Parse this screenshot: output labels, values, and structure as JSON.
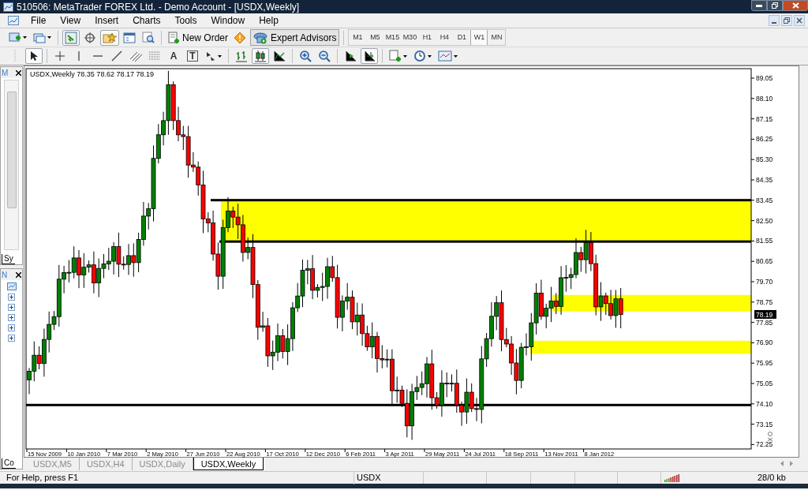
{
  "window": {
    "title": "510506: MetaTrader FOREX Ltd. - Demo Account - [USDX,Weekly]"
  },
  "menu": [
    "File",
    "View",
    "Insert",
    "Charts",
    "Tools",
    "Window",
    "Help"
  ],
  "toolbar": {
    "new_order": "New Order",
    "expert_advisors": {
      "label": "Expert Advisors",
      "selected": true
    },
    "timeframes": [
      {
        "label": "M1",
        "selected": false
      },
      {
        "label": "M5",
        "selected": false
      },
      {
        "label": "M15",
        "selected": false
      },
      {
        "label": "M30",
        "selected": false
      },
      {
        "label": "H1",
        "selected": false
      },
      {
        "label": "H4",
        "selected": false
      },
      {
        "label": "D1",
        "selected": false
      },
      {
        "label": "W1",
        "selected": true
      },
      {
        "label": "MN",
        "selected": false
      }
    ]
  },
  "drawing_tools": [
    {
      "selected": true
    },
    {
      "selected": false
    },
    {
      "selected": false
    },
    {
      "selected": false
    },
    {
      "selected": false
    },
    {
      "selected": false
    },
    {
      "selected": false
    },
    {
      "selected": false,
      "glyph": "A"
    },
    {
      "selected": false,
      "glyph": "T"
    },
    {
      "selected": false
    },
    {
      "selected": false
    },
    {
      "selected": true
    },
    {
      "selected": false
    },
    {
      "selected": false
    },
    {
      "selected": false
    },
    {
      "selected": false
    },
    {
      "selected": true
    },
    {
      "selected": false
    },
    {
      "selected": false
    },
    {
      "selected": false
    }
  ],
  "market_watch_panel": {
    "title": "M",
    "tab": "Sy"
  },
  "navigator_panel": {
    "title": "N",
    "tab": "Co"
  },
  "chart": {
    "header": "USDX,Weekly  78.35 78.62 78.17 78.19",
    "current_price": "78.19",
    "price_labels": [
      "89.05",
      "88.10",
      "87.15",
      "86.25",
      "85.30",
      "84.35",
      "83.45",
      "82.50",
      "81.55",
      "80.65",
      "79.70",
      "78.75",
      "77.85",
      "76.90",
      "75.95",
      "75.05",
      "74.10",
      "73.15",
      "72.25"
    ],
    "date_labels": [
      "15 Nov 2009",
      "10 Jan 2010",
      "7 Mar 2010",
      "2 May 2010",
      "27 Jun 2010",
      "22 Aug 2010",
      "17 Oct 2010",
      "12 Dec 2010",
      "6 Feb 2011",
      "3 Apr 2011",
      "29 May 2011",
      "24 Jul 2011",
      "18 Sep 2011",
      "13 Nov 2011",
      "8 Jan 2012"
    ]
  },
  "chart_tabs": [
    {
      "label": "USDX,M5",
      "selected": false
    },
    {
      "label": "USDX,H4",
      "selected": false
    },
    {
      "label": "USDX,Daily",
      "selected": false
    },
    {
      "label": "USDX,Weekly",
      "selected": true
    }
  ],
  "status_bar": {
    "help": "For Help, press F1",
    "symbol": "USDX",
    "traffic": "28/0 kb"
  }
}
